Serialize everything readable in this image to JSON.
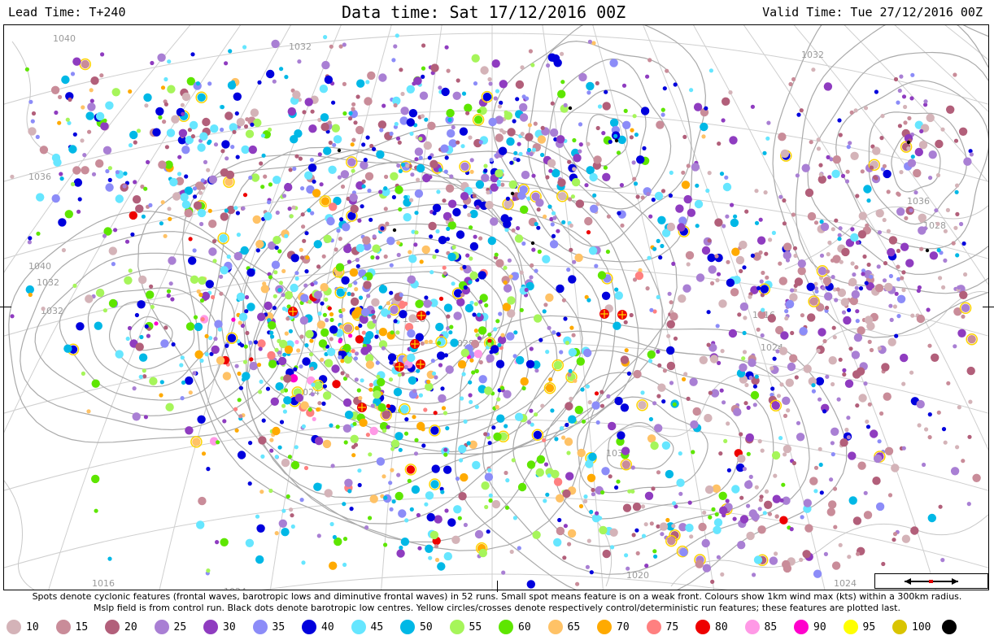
{
  "header": {
    "lead_time": "Lead Time: T+240",
    "data_time": "Data time:  Sat 17/12/2016 00Z",
    "valid_time": "Valid Time: Tue 27/12/2016 00Z"
  },
  "caption": {
    "line1": "Spots denote cyclonic features (frontal waves, barotropic lows and diminutive frontal waves) in 52 runs. Small spot means feature is on a weak front. Colours show 1km wind max (kts) within a 300km radius.",
    "line2": "Mslp field is from control run. Black dots denote barotropic low centres. Yellow circles/crosses denote respectively control/deterministic run features; these features are plotted last."
  },
  "legend": [
    {
      "label": "10",
      "color": "#d4b3b8"
    },
    {
      "label": "15",
      "color": "#c98c99"
    },
    {
      "label": "20",
      "color": "#b25f7a"
    },
    {
      "label": "25",
      "color": "#a97fd4"
    },
    {
      "label": "30",
      "color": "#8f3cc0"
    },
    {
      "label": "35",
      "color": "#8c8cf8"
    },
    {
      "label": "40",
      "color": "#0000dd"
    },
    {
      "label": "45",
      "color": "#66e6ff"
    },
    {
      "label": "50",
      "color": "#00b8e6"
    },
    {
      "label": "55",
      "color": "#a6f55a"
    },
    {
      "label": "60",
      "color": "#5ee600"
    },
    {
      "label": "65",
      "color": "#ffc266"
    },
    {
      "label": "70",
      "color": "#ffaa00"
    },
    {
      "label": "75",
      "color": "#ff8080"
    },
    {
      "label": "80",
      "color": "#ee0000"
    },
    {
      "label": "85",
      "color": "#ff99e6"
    },
    {
      "label": "90",
      "color": "#ff00cc"
    },
    {
      "label": "95",
      "color": "#ffff00"
    },
    {
      "label": "100",
      "color": "#d9c400"
    },
    {
      "label": "",
      "color": "#000000"
    }
  ],
  "contour_labels": [
    "1040",
    "1032",
    "1040",
    "1036",
    "1032",
    "1028",
    "1024",
    "1024",
    "1032",
    "1032",
    "1036",
    "1032",
    "1024",
    "1016",
    "1024",
    "1028",
    "1020",
    "1028",
    "1016"
  ]
}
